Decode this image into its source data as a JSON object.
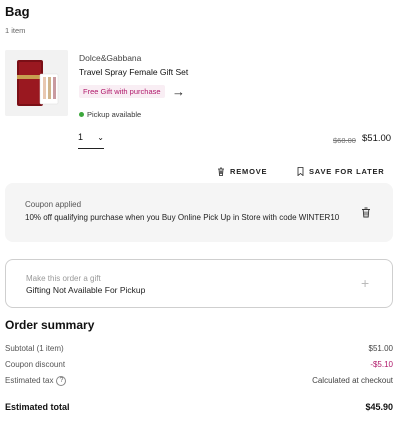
{
  "header": {
    "title": "Bag",
    "count": "1 item"
  },
  "item": {
    "brand": "Dolce&Gabbana",
    "name": "Travel Spray Female Gift Set",
    "gift_pill": "Free Gift with purchase",
    "pickup": "Pickup available",
    "quantity": "1",
    "price_original": "$68.00",
    "price_current": "$51.00",
    "remove_label": "REMOVE",
    "save_label": "SAVE FOR LATER"
  },
  "coupon": {
    "label": "Coupon applied",
    "description": "10% off qualifying purchase when you Buy Online Pick Up in Store with code WINTER10"
  },
  "gifting": {
    "label": "Make this order a gift",
    "value": "Gifting Not Available For Pickup"
  },
  "summary": {
    "title": "Order summary",
    "subtotal_label": "Subtotal (1 item)",
    "subtotal_value": "$51.00",
    "coupon_label": "Coupon discount",
    "coupon_value": "-$5.10",
    "tax_label": "Estimated tax",
    "tax_value": "Calculated at checkout",
    "total_label": "Estimated total",
    "total_value": "$45.90"
  },
  "colors": {
    "accent": "#b0186a",
    "pickup_dot": "#3ca73c"
  }
}
